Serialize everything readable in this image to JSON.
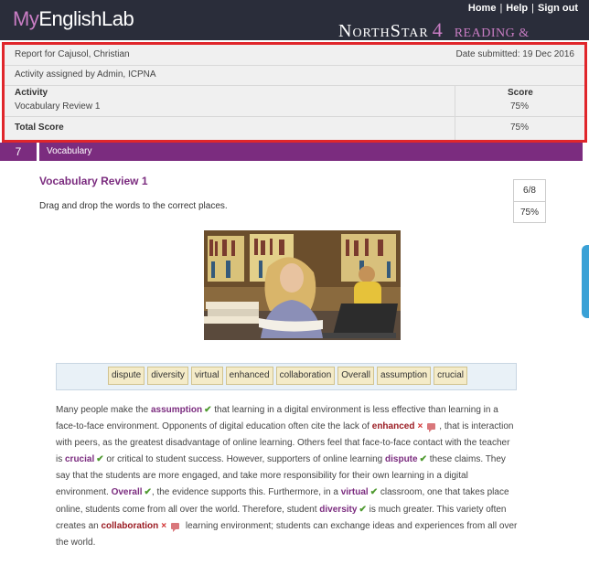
{
  "header": {
    "logo_prefix": "My",
    "logo_main": "EnglishLab",
    "links": [
      "Home",
      "Help",
      "Sign out"
    ],
    "link_separator": "|",
    "brand_name": "NorthStar",
    "brand_level": "4",
    "brand_sub": "READING & WRITING"
  },
  "report": {
    "report_for": "Report for Cajusol, Christian",
    "date_submitted": "Date submitted: 19 Dec 2016",
    "assigned_by": "Activity assigned by Admin, ICPNA",
    "activity_header": "Activity",
    "score_header": "Score",
    "activity_name": "Vocabulary Review 1",
    "activity_score": "75%",
    "total_label": "Total Score",
    "total_score": "75%"
  },
  "section": {
    "number": "7",
    "title": "Vocabulary"
  },
  "activity": {
    "title": "Vocabulary Review 1",
    "instructions": "Drag and drop the words to the correct places.",
    "score_fraction": "6/8",
    "score_percent": "75%"
  },
  "word_bank": [
    "dispute",
    "diversity",
    "virtual",
    "enhanced",
    "collaboration",
    "Overall",
    "assumption",
    "crucial"
  ],
  "passage": {
    "t1": "Many people make the ",
    "w1": "assumption",
    "t2": " that learning in a digital environment is less effective than learning in a face-to-face environment. Opponents of digital education often cite the lack of ",
    "w2": "enhanced",
    "t3": ", that is interaction with peers, as the greatest disadvantage of online learning. Others feel that face-to-face contact with the teacher is ",
    "w3": "crucial",
    "t4": " or critical to student success. However, supporters of online learning ",
    "w4": "dispute",
    "t5": " these claims. They say that the students are more engaged, and take more responsibility for their own learning in a digital environment. ",
    "w5": "Overall",
    "t6": ", the evidence supports this. Furthermore, in a ",
    "w6": "virtual",
    "t7": " classroom, one that takes place online, students come from all over the world. Therefore, student ",
    "w7": "diversity",
    "t8": " is much greater. This variety often creates an ",
    "w8": "collaboration",
    "t9": " learning environment; students can exchange ideas and experiences from all over the world.",
    "tick": "✔",
    "cross": "×"
  },
  "colors": {
    "topbar": "#2a2d3a",
    "brand_purple": "#7b2c7f",
    "highlight_border": "#e0262b",
    "correct": "#4f9a30",
    "incorrect": "#d23131"
  }
}
